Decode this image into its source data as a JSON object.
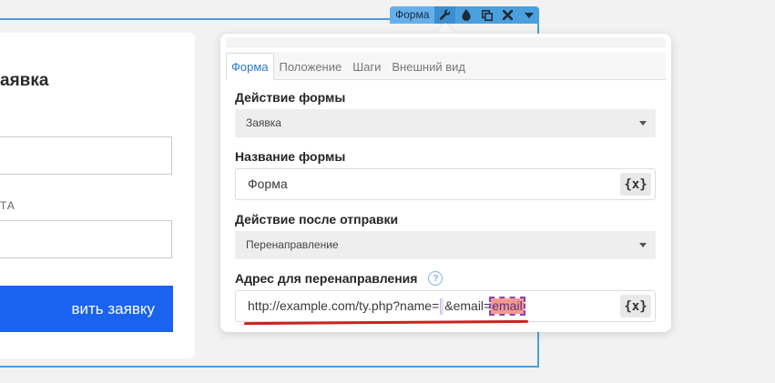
{
  "background_card": {
    "title": "аявка",
    "field_label": "ТА",
    "submit_label": "вить заявку"
  },
  "toolbar": {
    "label": "Форма",
    "icons": [
      "wrench-icon",
      "drop-icon",
      "copy-icon",
      "close-icon",
      "caret-down-icon"
    ]
  },
  "panel": {
    "tabs": [
      {
        "label": "Форма",
        "active": true
      },
      {
        "label": "Положение",
        "active": false
      },
      {
        "label": "Шаги",
        "active": false
      },
      {
        "label": "Внешний вид",
        "active": false
      }
    ],
    "form_action": {
      "label": "Действие формы",
      "value": "Заявка"
    },
    "form_name": {
      "label": "Название формы",
      "value": "Форма",
      "var_button": "{x}"
    },
    "after_submit": {
      "label": "Действие после отправки",
      "value": "Перенаправление"
    },
    "redirect": {
      "label": "Адрес для перенаправления",
      "help": "?",
      "value_prefix": "http://example.com/ty.php?name=",
      "value_middle": "&email=",
      "value_var": "email",
      "var_button": "{x}"
    }
  },
  "colors": {
    "accent": "#4a9fdf",
    "tab_active": "#2b7ad1",
    "submit": "#1a63f0",
    "highlight_chip": "#f39a8e",
    "underline": "#c8241c"
  }
}
